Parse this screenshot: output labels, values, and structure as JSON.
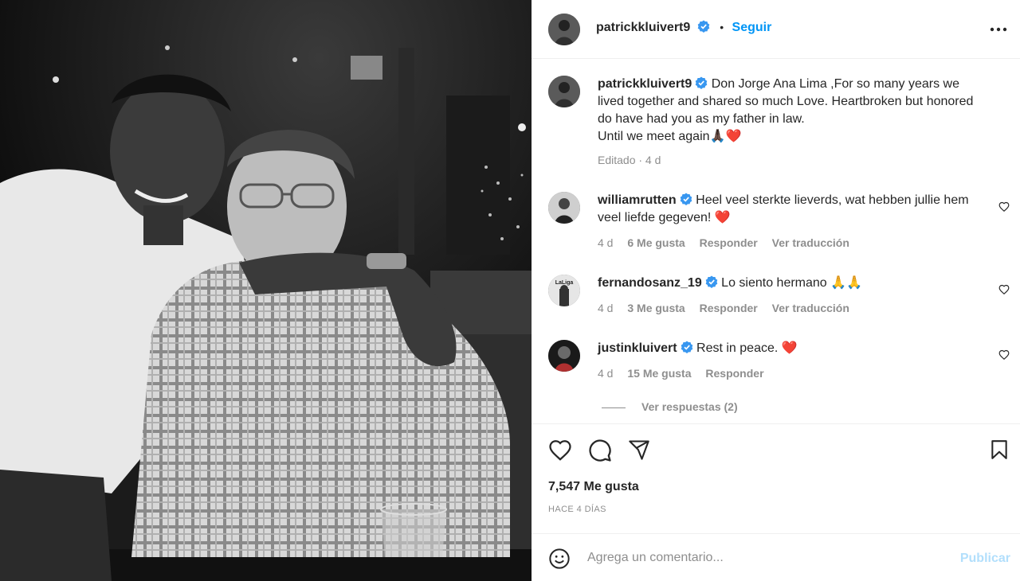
{
  "post": {
    "author": "patrickkluivert9",
    "follow_label": "Seguir",
    "separator": "•",
    "caption": "Don Jorge Ana Lima ,For so many years we lived together and shared so much Love. Heartbroken but honored do have had you as my father in law.",
    "caption_line2": "Until we meet again🙏🏿❤️",
    "caption_meta": "Editado · 4 d"
  },
  "comments": [
    {
      "user": "williamrutten",
      "text": "Heel veel sterkte lieverds, wat hebben jullie hem veel liefde gegeven! ❤️",
      "age": "4 d",
      "likes": "6 Me gusta",
      "reply": "Responder",
      "translate": "Ver traducción"
    },
    {
      "user": "fernandosanz_19",
      "text": "Lo siento hermano 🙏🙏",
      "age": "4 d",
      "likes": "3 Me gusta",
      "reply": "Responder",
      "translate": "Ver traducción"
    },
    {
      "user": "justinkluivert",
      "text": "Rest in peace. ❤️",
      "age": "4 d",
      "likes": "15 Me gusta",
      "reply": "Responder"
    }
  ],
  "replies_label": "Ver respuestas (2)",
  "stats": {
    "likes": "7,547 Me gusta",
    "time": "HACE 4 DÍAS"
  },
  "composer": {
    "placeholder": "Agrega un comentario...",
    "publish": "Publicar"
  },
  "colors": {
    "accent": "#0095f6",
    "verified": "#3897f0",
    "heart_red": "#ed4956",
    "muted": "#8e8e8e"
  },
  "icons": [
    "like-icon",
    "comment-icon",
    "share-icon",
    "save-icon",
    "emoji-icon",
    "more-icon",
    "verified-icon"
  ]
}
